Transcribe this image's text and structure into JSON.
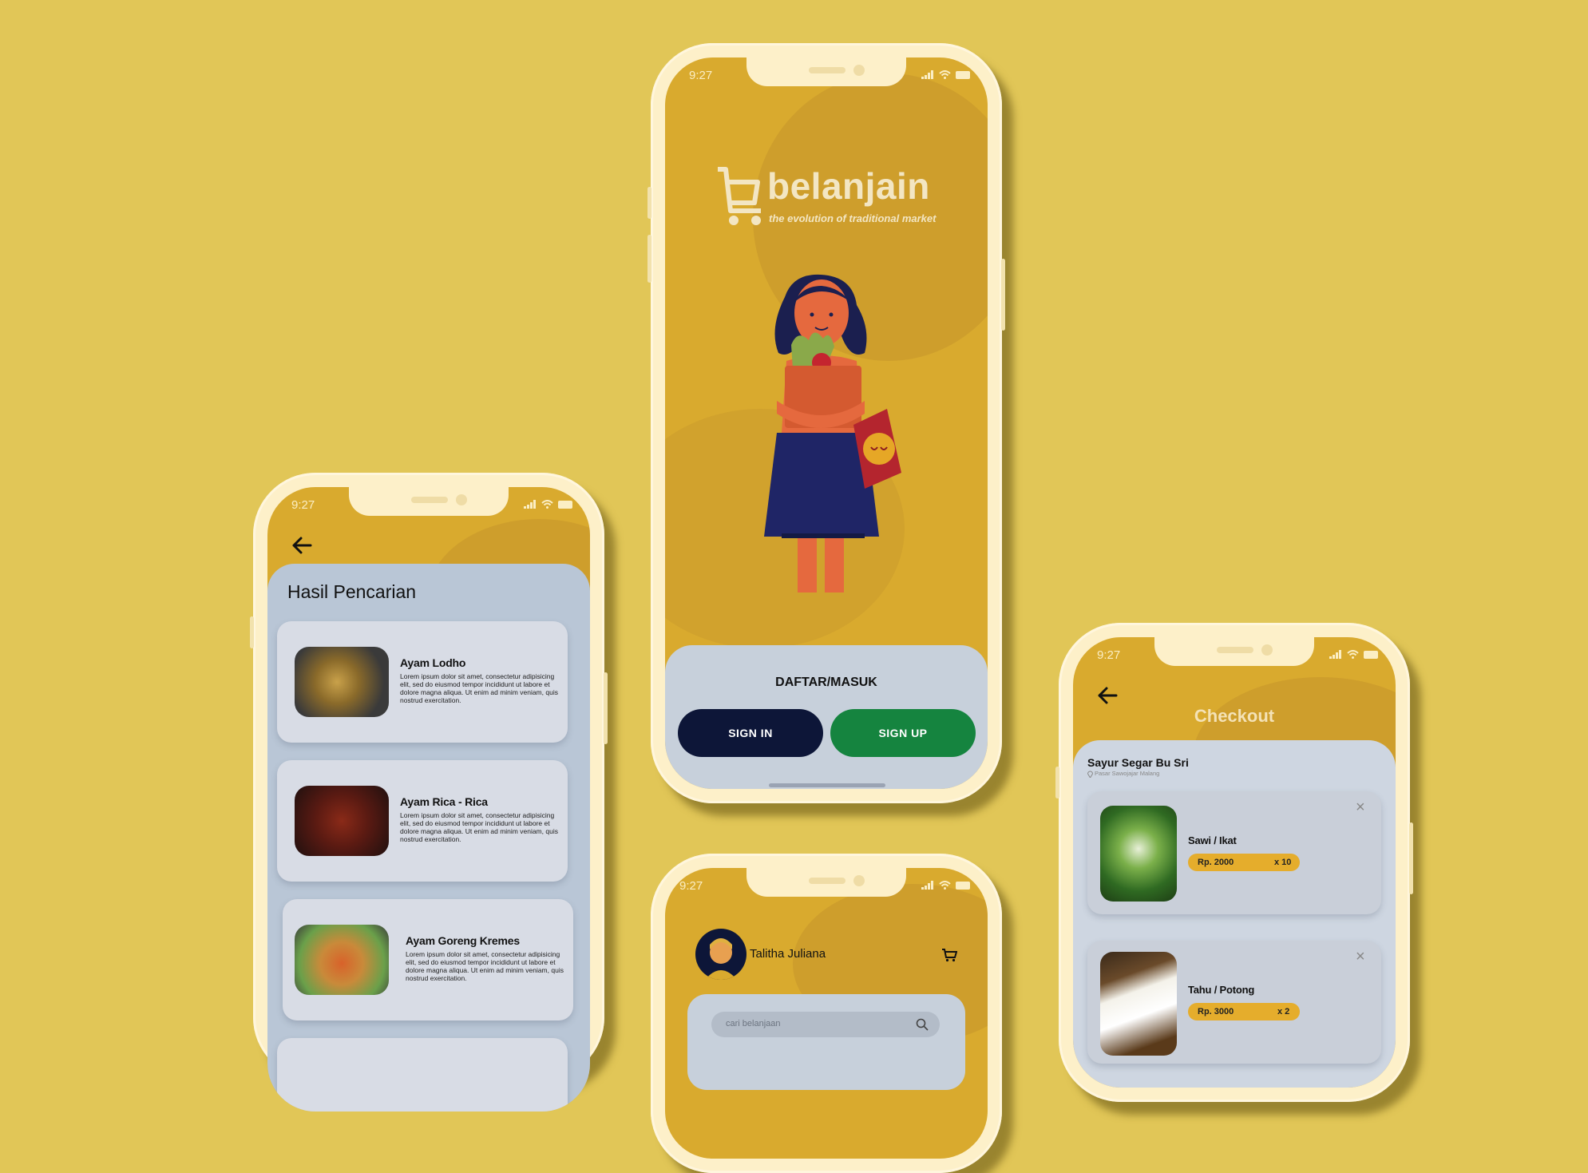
{
  "colors": {
    "background": "#e1c657",
    "brand_yellow": "#d9aa2e",
    "panel": "#c7d0db",
    "navy": "#0d1638",
    "green": "#15843f",
    "price_pill": "#e5ad2c"
  },
  "status_time": "9:27",
  "splash": {
    "logo_name": "belanjain",
    "tagline": "the evolution of traditional market",
    "prompt": "DAFTAR/MASUK",
    "sign_in": "SIGN IN",
    "sign_up": "SIGN UP"
  },
  "search_results": {
    "title": "Hasil Pencarian",
    "items": [
      {
        "name": "Ayam Lodho",
        "desc": "Lorem ipsum dolor sit amet, consectetur adipisicing elit, sed do eiusmod tempor incididunt ut labore et dolore magna aliqua. Ut enim ad minim veniam, quis nostrud exercitation."
      },
      {
        "name": "Ayam Rica - Rica",
        "desc": "Lorem ipsum dolor sit amet, consectetur adipisicing elit, sed do eiusmod tempor incididunt ut labore et dolore magna aliqua. Ut enim ad minim veniam, quis nostrud exercitation."
      },
      {
        "name": "Ayam Goreng Kremes",
        "desc": "Lorem ipsum dolor sit amet, consectetur adipisicing elit, sed do eiusmod tempor incididunt ut labore et dolore magna aliqua. Ut enim ad minim veniam, quis nostrud exercitation."
      }
    ]
  },
  "home": {
    "user_name": "Talitha Juliana",
    "search_placeholder": "cari belanjaan"
  },
  "checkout": {
    "title": "Checkout",
    "store_name": "Sayur Segar Bu Sri",
    "store_location": "Pasar Sawojajar Malang",
    "items": [
      {
        "name": "Sawi / Ikat",
        "price": "Rp. 2000",
        "qty": "x 10"
      },
      {
        "name": "Tahu / Potong",
        "price": "Rp. 3000",
        "qty": "x 2"
      }
    ]
  },
  "icons": [
    "back-arrow-icon",
    "cart-icon",
    "search-icon",
    "close-icon",
    "signal-icon",
    "wifi-icon",
    "battery-icon",
    "location-pin-icon",
    "shopping-cart-logo-icon"
  ]
}
